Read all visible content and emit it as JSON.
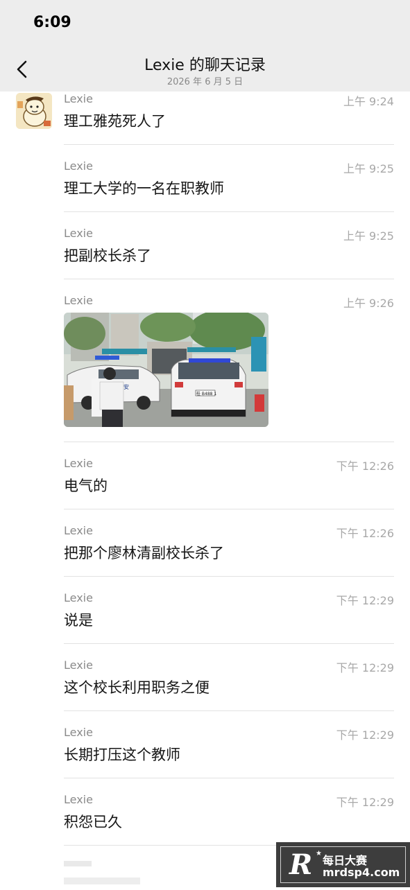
{
  "status_bar": {
    "time": "6:09"
  },
  "header": {
    "title": "Lexie 的聊天记录",
    "subtitle": "2026 年 6 月 5 日",
    "back_icon": "chevron-left-icon"
  },
  "messages": [
    {
      "sender": "Lexie",
      "time": "上午 9:24",
      "text": "理工雅苑死人了"
    },
    {
      "sender": "Lexie",
      "time": "上午 9:25",
      "text": "理工大学的一名在职教师"
    },
    {
      "sender": "Lexie",
      "time": "上午 9:25",
      "text": "把副校长杀了"
    },
    {
      "sender": "Lexie",
      "time": "上午 9:26",
      "image": "police-cars-at-campus-gate-photo",
      "plate_text": "桂 B488 1",
      "car_text": "公安"
    },
    {
      "sender": "Lexie",
      "time": "下午 12:26",
      "text": "电气的"
    },
    {
      "sender": "Lexie",
      "time": "下午 12:26",
      "text": "把那个廖林清副校长杀了"
    },
    {
      "sender": "Lexie",
      "time": "下午 12:29",
      "text": "说是"
    },
    {
      "sender": "Lexie",
      "time": "下午 12:29",
      "text": "这个校长利用职务之便"
    },
    {
      "sender": "Lexie",
      "time": "下午 12:29",
      "text": "长期打压这个教师"
    },
    {
      "sender": "Lexie",
      "time": "下午 12:29",
      "text": "积怨已久"
    }
  ],
  "watermark": {
    "logo": "R",
    "name": "每日大赛",
    "site": "mrdsp4.com"
  },
  "colors": {
    "header_bg": "#ededed",
    "divider": "#e2e2e2",
    "time_text": "#a8a8a8",
    "sender_text": "#8a8a8a"
  }
}
